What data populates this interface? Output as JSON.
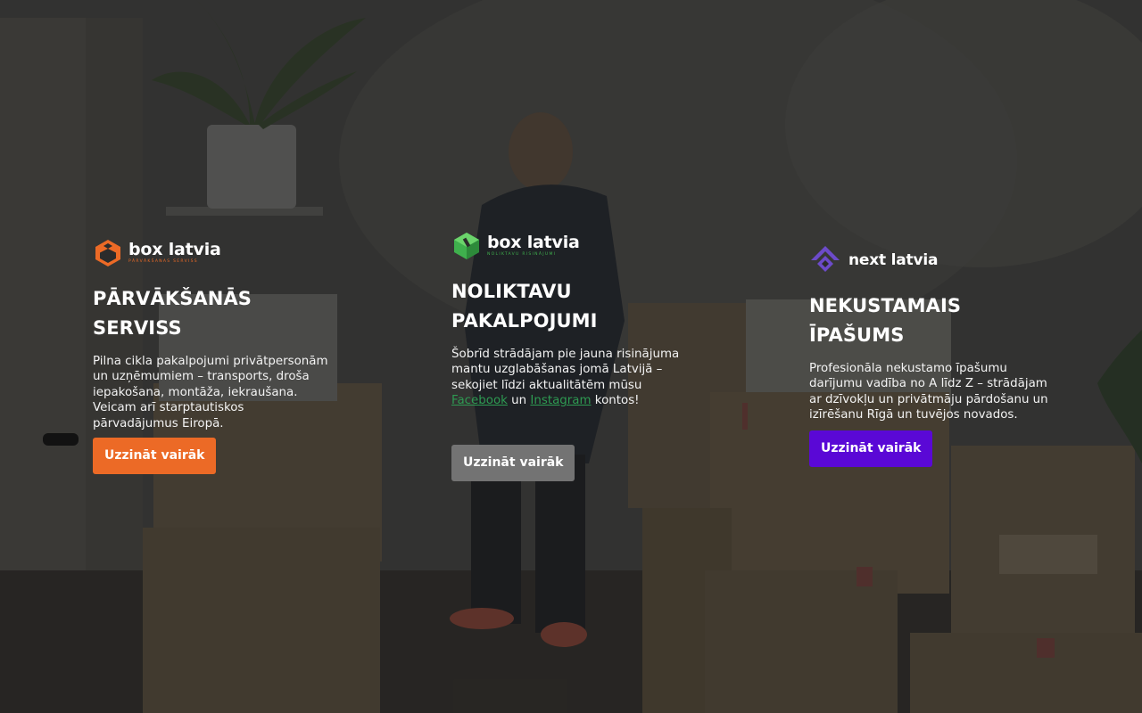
{
  "colors": {
    "orange": "#ec6a26",
    "green": "#3fb04d",
    "gray_button": "#737373",
    "purple": "#5a08d6",
    "purple_logo": "#6c4bc9",
    "link_green": "#2e9a52"
  },
  "cards": [
    {
      "brand": "box latvia",
      "tagline": "PĀRVĀKŠANAS SERVISS",
      "logo_icon": "box-hex-orange-icon",
      "heading": "PĀRVĀKŠANĀS SERVISS",
      "description": "Pilna cikla pakalpojumi privātpersonām un uzņēmumiem – transports, droša iepakošana, montāža, iekraušana. Veicam arī starptautiskos pārvadājumus Eiropā.",
      "button": "Uzzināt vairāk"
    },
    {
      "brand": "box latvia",
      "tagline": "NOLIKTAVU RISINĀJUMI",
      "logo_icon": "box-cube-green-icon",
      "heading_line1": "NOLIKTAVU",
      "heading_line2": "PAKALPOJUMI",
      "description_part1": "Šobrīd strādājam pie jauna risinājuma mantu uzglabāšanas jomā Latvijā – sekojiet līdzi aktualitātēm mūsu ",
      "link_facebook": "Facebook",
      "description_join": " un ",
      "link_instagram": "Instagram",
      "description_part2": " kontos!",
      "button": "Uzzināt vairāk"
    },
    {
      "brand": "next latvia",
      "logo_icon": "next-house-purple-icon",
      "heading": "NEKUSTAMAIS ĪPAŠUMS",
      "description": "Profesionāla nekustamo īpašumu darījumu vadība no A līdz Z – strādājam ar dzīvokļu un privātmāju pārdošanu un izīrēšanu Rīgā un tuvējos novados.",
      "button": "Uzzināt vairāk"
    }
  ]
}
